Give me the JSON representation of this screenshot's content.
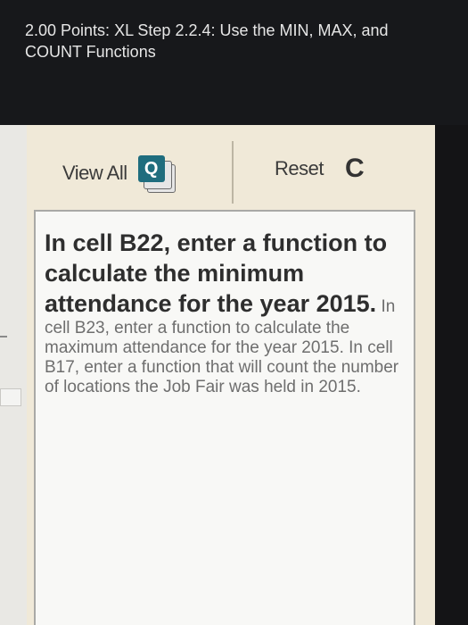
{
  "header": {
    "title": "2.00 Points: XL Step 2.2.4: Use the MIN, MAX, and COUNT Functions"
  },
  "toolbar": {
    "view_all_label": "View All",
    "view_all_icon": "Q",
    "reset_label": "Reset",
    "reset_icon": "C"
  },
  "instructions": {
    "bold_text": "In cell B22, enter a function to calculate the minimum attendance for the year 2015.",
    "normal_text": " In cell B23, enter a function to calculate the maximum attendance for the year 2015. In cell B17, enter a function that will count the number of locations the Job Fair was held in 2015."
  },
  "colors": {
    "header_bg": "#17181b",
    "panel_bg": "#f0e9d8",
    "icon_accent": "#1f6d7e"
  }
}
